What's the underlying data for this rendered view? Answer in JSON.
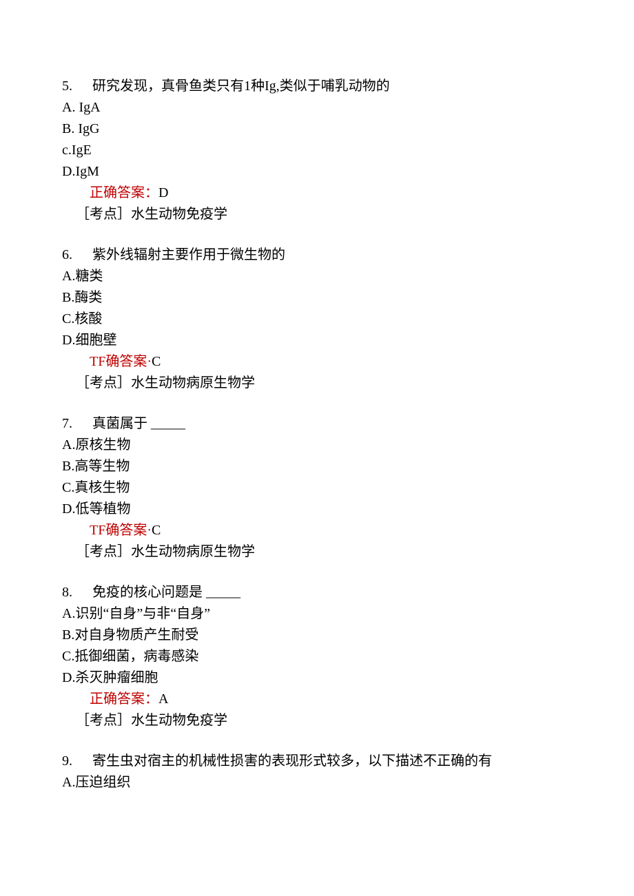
{
  "questions": [
    {
      "num": "5.",
      "stem": "研究发现，真骨鱼类只有1种Ig,类似于哺乳动物的",
      "options": [
        "A. IgA",
        "B. IgG",
        "c.IgE",
        "D.IgM"
      ],
      "answer_label": "正确答案：",
      "answer_value": "D",
      "topic_label": "［考点］",
      "topic_value": "水生动物免疫学"
    },
    {
      "num": "6.",
      "stem": "紫外线辐射主要作用于微生物的",
      "options": [
        "A.糖类",
        "B.酶类",
        "C.核酸",
        "D.细胞壁"
      ],
      "answer_label": "TF确答案·",
      "answer_value": "C",
      "topic_label": "［考点］",
      "topic_value": "水生动物病原生物学"
    },
    {
      "num": "7.",
      "stem": "真菌属于 ",
      "blank": "_____",
      "options": [
        "A.原核生物",
        "B.高等生物",
        "C.真核生物",
        "D.低等植物"
      ],
      "answer_label": "TF确答案·",
      "answer_value": "C",
      "topic_label": "［考点］",
      "topic_value": "水生动物病原生物学"
    },
    {
      "num": "8.",
      "stem": "免疫的核心问题是 ",
      "blank": "_____",
      "options": [
        "A.识别“自身”与非“自身”",
        "B.对自身物质产生耐受",
        "C.抵御细菌，病毒感染",
        "D.杀灭肿瘤细胞"
      ],
      "answer_label": "正确答案：",
      "answer_value": "A",
      "topic_label": "［考点］",
      "topic_value": "水生动物免疫学"
    },
    {
      "num": "9.",
      "stem": "寄生虫对宿主的机械性损害的表现形式较多，以下描述不正确的有",
      "options": [
        "A.压迫组织"
      ]
    }
  ]
}
